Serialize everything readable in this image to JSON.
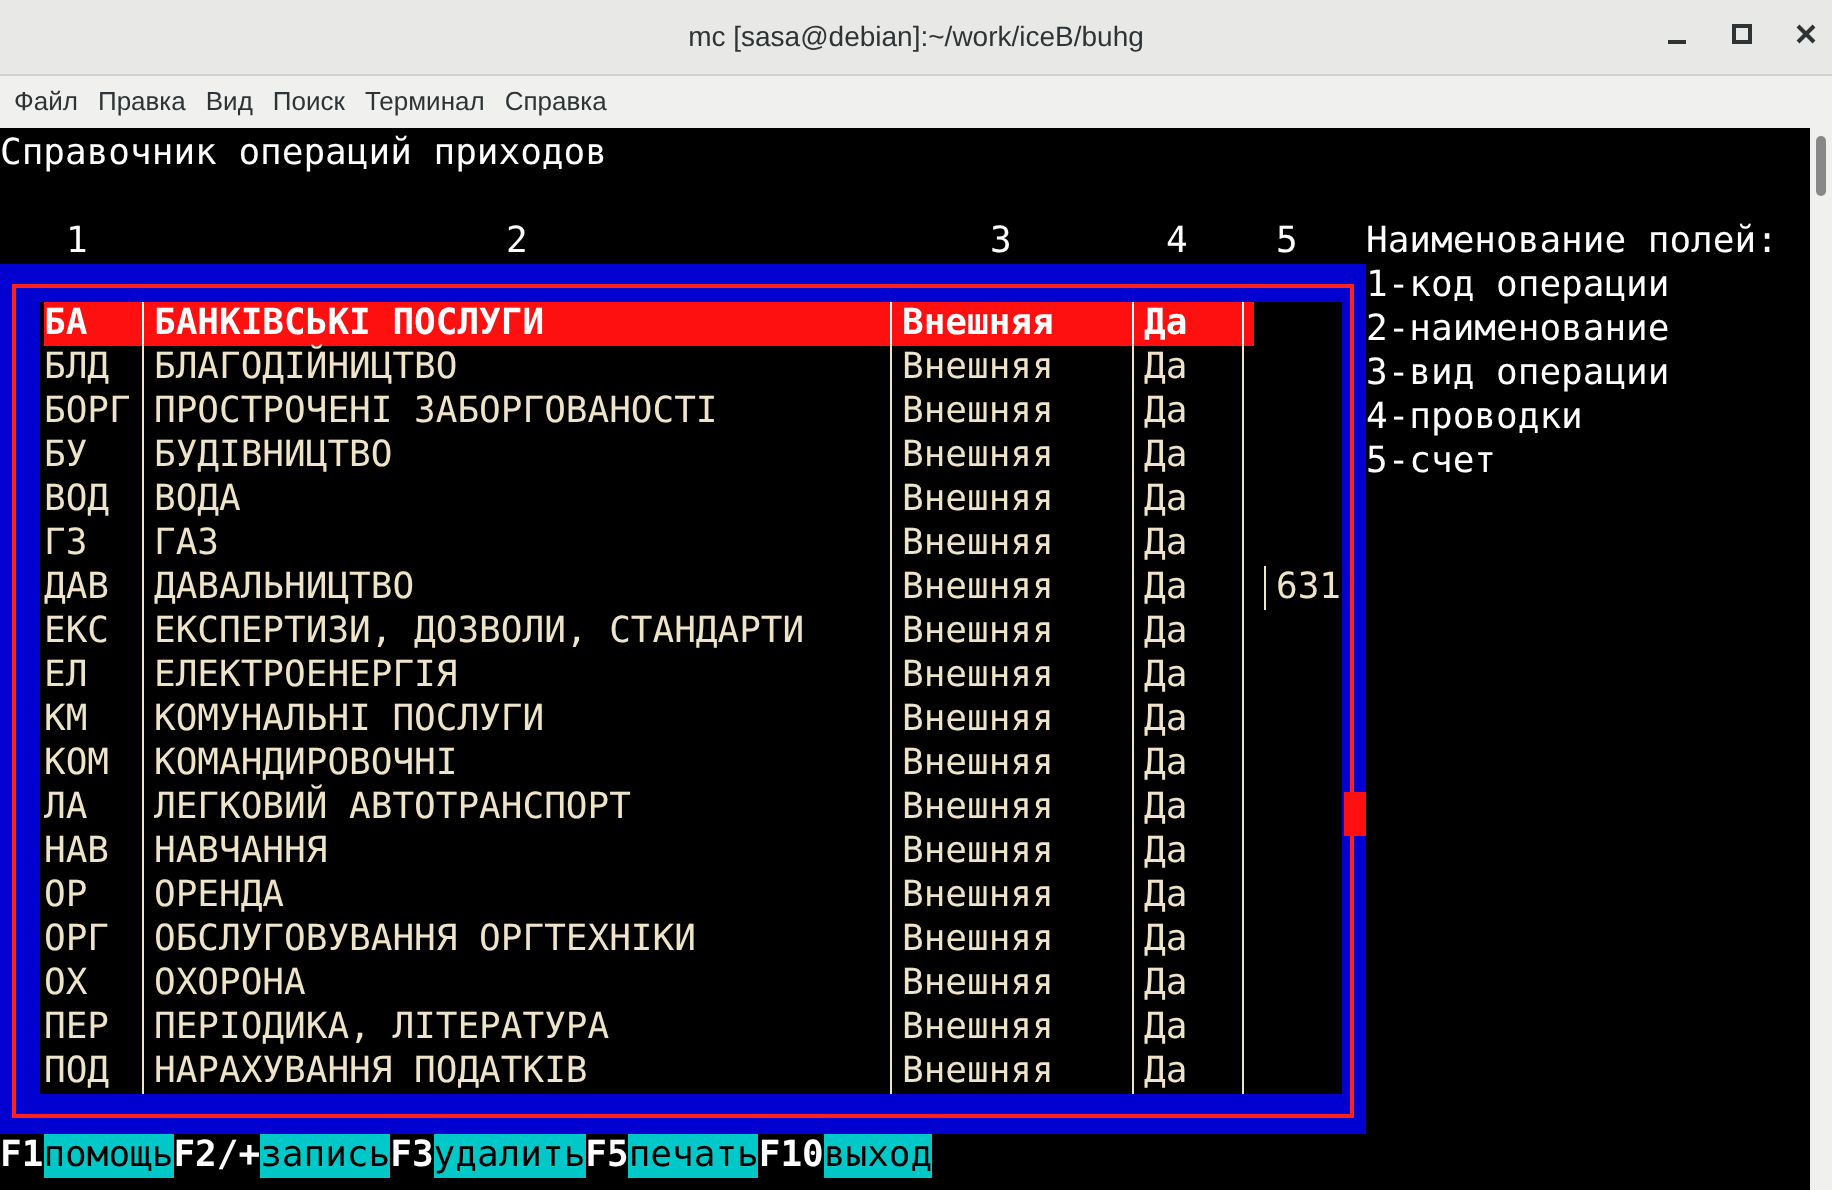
{
  "window": {
    "title": "mc [sasa@debian]:~/work/iceB/buhg"
  },
  "menu": [
    "Файл",
    "Правка",
    "Вид",
    "Поиск",
    "Терминал",
    "Справка"
  ],
  "screen_title": "Справочник операций приходов",
  "column_numbers": [
    "1",
    "2",
    "3",
    "4",
    "5"
  ],
  "rows": [
    {
      "code": "БА",
      "name": "БАНКІВСЬКІ ПОСЛУГИ",
      "type": "Внешняя",
      "postings": "Да",
      "selected": true
    },
    {
      "code": "БЛД",
      "name": "БЛАГОДІЙНИЦТВО",
      "type": "Внешняя",
      "postings": "Да",
      "selected": false
    },
    {
      "code": "БОРГ",
      "name": "ПРОСТРОЧЕНІ ЗАБОРГОВАНОСТІ",
      "type": "Внешняя",
      "postings": "Да",
      "selected": false
    },
    {
      "code": "БУ",
      "name": "БУДІВНИЦТВО",
      "type": "Внешняя",
      "postings": "Да",
      "selected": false
    },
    {
      "code": "ВОД",
      "name": "ВОДА",
      "type": "Внешняя",
      "postings": "Да",
      "selected": false
    },
    {
      "code": "ГЗ",
      "name": "ГАЗ",
      "type": "Внешняя",
      "postings": "Да",
      "selected": false
    },
    {
      "code": "ДАВ",
      "name": "ДАВАЛЬНИЦТВО",
      "type": "Внешняя",
      "postings": "Да",
      "account": "631",
      "selected": false
    },
    {
      "code": "ЕКС",
      "name": "ЕКСПЕРТИЗИ, ДОЗВОЛИ, СТАНДАРТИ",
      "type": "Внешняя",
      "postings": "Да",
      "selected": false
    },
    {
      "code": "ЕЛ",
      "name": "ЕЛЕКТРОЕНЕРГІЯ",
      "type": "Внешняя",
      "postings": "Да",
      "selected": false
    },
    {
      "code": "КМ",
      "name": "КОМУНАЛЬНІ ПОСЛУГИ",
      "type": "Внешняя",
      "postings": "Да",
      "selected": false
    },
    {
      "code": "КОМ",
      "name": "КОМАНДИРОВОЧНІ",
      "type": "Внешняя",
      "postings": "Да",
      "selected": false
    },
    {
      "code": "ЛА",
      "name": "ЛЕГКОВИЙ АВТОТРАНСПОРТ",
      "type": "Внешняя",
      "postings": "Да",
      "selected": false
    },
    {
      "code": "НАВ",
      "name": "НАВЧАННЯ",
      "type": "Внешняя",
      "postings": "Да",
      "selected": false
    },
    {
      "code": "ОР",
      "name": "ОРЕНДА",
      "type": "Внешняя",
      "postings": "Да",
      "selected": false
    },
    {
      "code": "ОРГ",
      "name": "ОБСЛУГОВУВАННЯ ОРГТЕХНІКИ",
      "type": "Внешняя",
      "postings": "Да",
      "selected": false
    },
    {
      "code": "ОХ",
      "name": "ОХОРОНА",
      "type": "Внешняя",
      "postings": "Да",
      "selected": false
    },
    {
      "code": "ПЕР",
      "name": "ПЕРІОДИКА, ЛІТЕРАТУРА",
      "type": "Внешняя",
      "postings": "Да",
      "selected": false
    },
    {
      "code": "ПОД",
      "name": "НАРАХУВАННЯ ПОДАТКІВ",
      "type": "Внешняя",
      "postings": "Да",
      "selected": false
    }
  ],
  "legend": {
    "title": "Наименование полей:",
    "items": [
      "1-код операции",
      "2-наименование",
      "3-вид операции",
      "4-проводки",
      "5-счет"
    ]
  },
  "function_keys": [
    {
      "key": "F1",
      "label": "помощь"
    },
    {
      "key": "F2/+",
      "label": "запись"
    },
    {
      "key": "F3",
      "label": "удалить"
    },
    {
      "key": "F5",
      "label": "печать"
    },
    {
      "key": "F10",
      "label": "выход"
    }
  ]
}
